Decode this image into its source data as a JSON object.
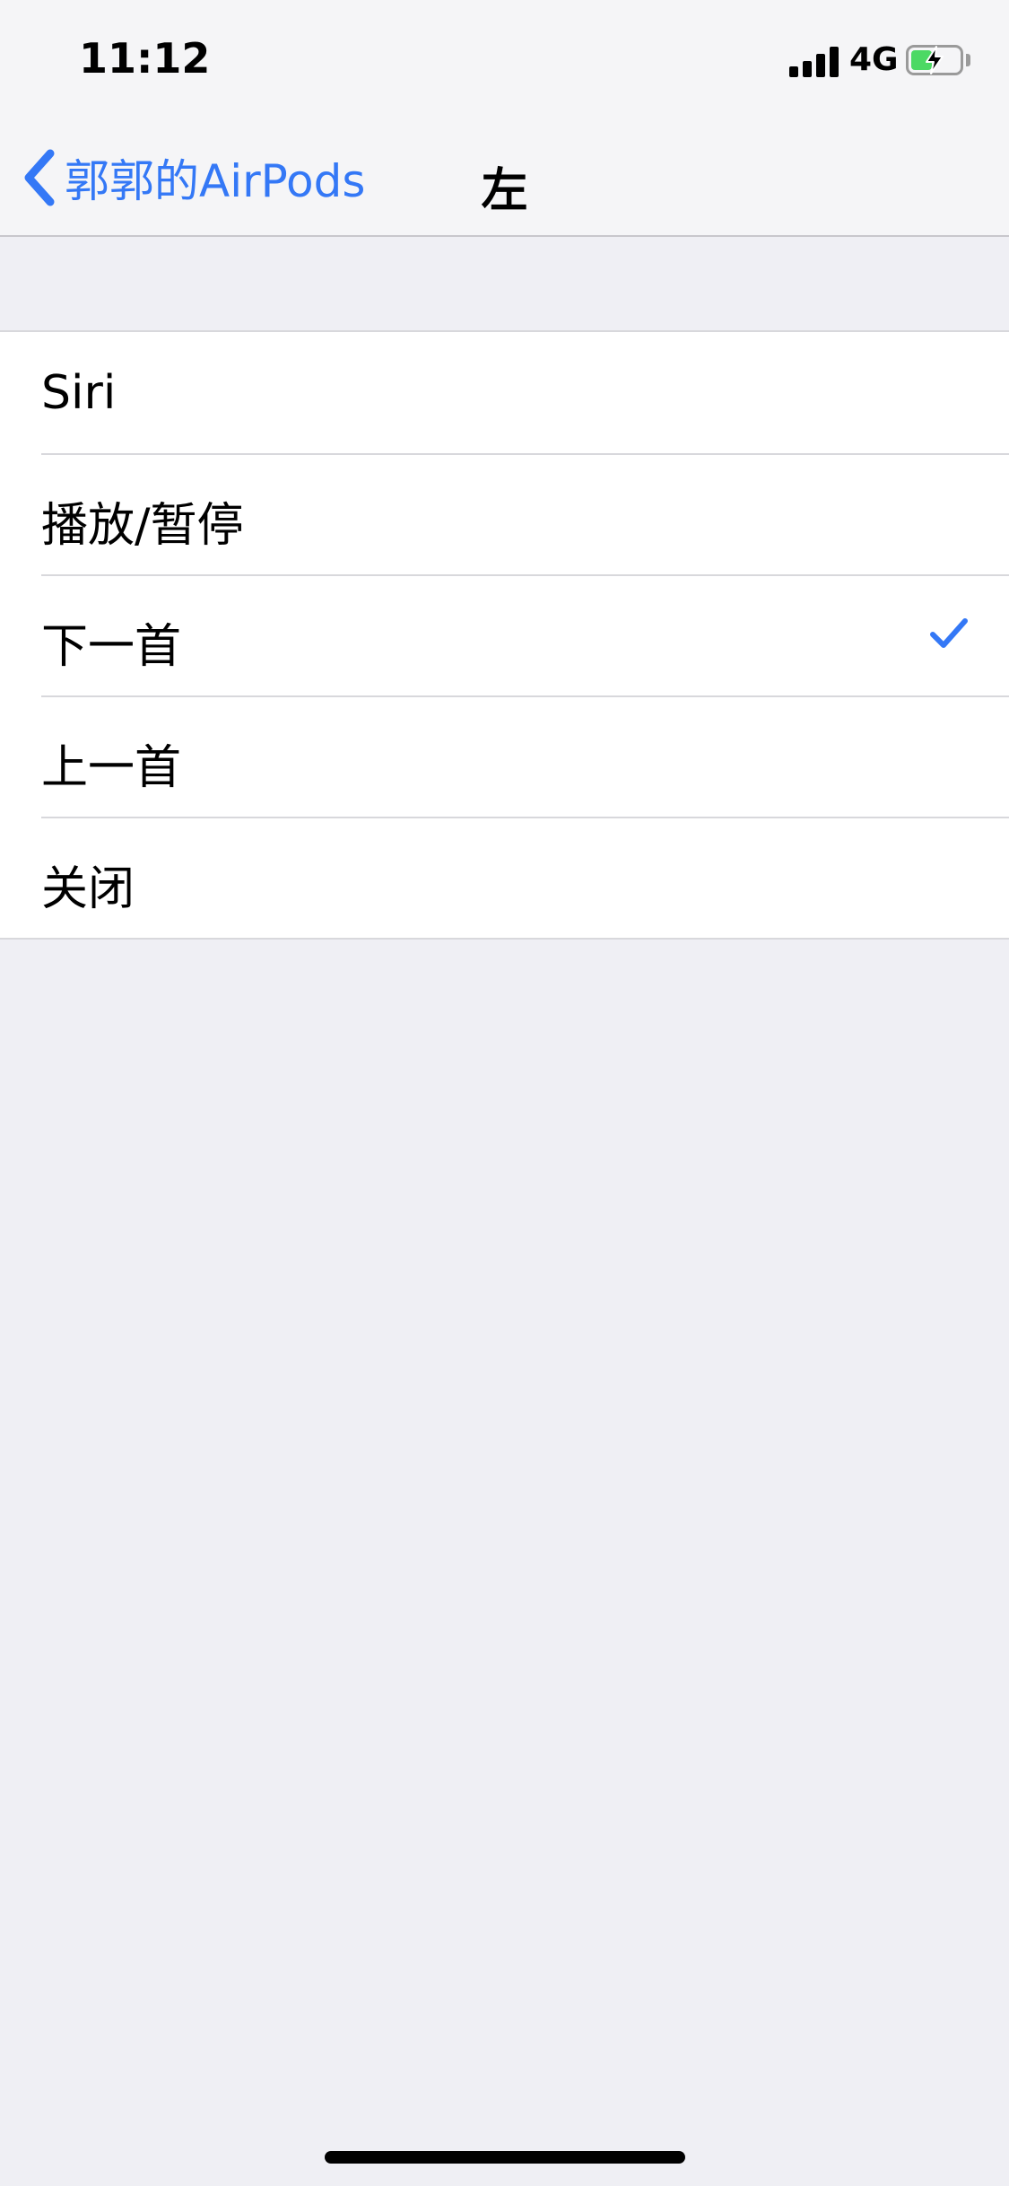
{
  "status_bar": {
    "time": "11:12",
    "network": "4G",
    "signal_bars": 4,
    "battery_level": 0.45,
    "charging": true,
    "battery_color": "#4cd964"
  },
  "nav": {
    "back_label": "郭郭的AirPods",
    "title": "左",
    "accent_color": "#3478f6"
  },
  "options": [
    {
      "label": "Siri",
      "selected": false
    },
    {
      "label": "播放/暂停",
      "selected": false
    },
    {
      "label": "下一首",
      "selected": true
    },
    {
      "label": "上一首",
      "selected": false
    },
    {
      "label": "关闭",
      "selected": false
    }
  ],
  "icons": {
    "back": "chevron-left-icon",
    "selected": "checkmark-icon",
    "charging": "bolt-icon"
  }
}
